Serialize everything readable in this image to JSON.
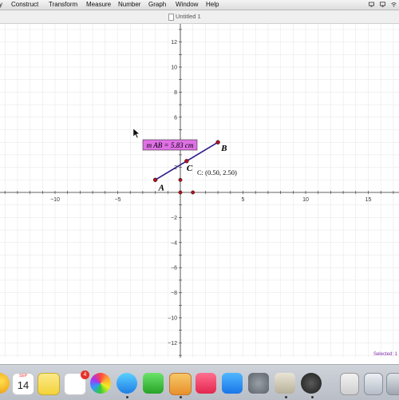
{
  "menu": {
    "items": [
      "y",
      "Construct",
      "Transform",
      "Measure",
      "Number",
      "Graph",
      "Window",
      "Help"
    ]
  },
  "window": {
    "title": "Untitled 1"
  },
  "graph": {
    "x_tick_labels": [
      "−10",
      "−5",
      "5",
      "10",
      "15"
    ],
    "x_tick_values": [
      -10,
      -5,
      5,
      10,
      15
    ],
    "y_tick_labels": [
      "12",
      "10",
      "8",
      "6",
      "4",
      "2",
      "−2",
      "−4",
      "−6",
      "−8",
      "−10",
      "−12"
    ],
    "y_tick_values": [
      12,
      10,
      8,
      6,
      4,
      2,
      -2,
      -4,
      -6,
      -8,
      -10,
      -12
    ],
    "points": [
      {
        "label": "A",
        "x": -2,
        "y": 1
      },
      {
        "label": "B",
        "x": 3,
        "y": 4
      },
      {
        "label": "C",
        "x": 0.5,
        "y": 2.5
      }
    ],
    "extra_points": [
      {
        "x": 0,
        "y": 1
      },
      {
        "x": 0,
        "y": 0
      },
      {
        "x": 1,
        "y": 0
      }
    ],
    "measurement": "m AB = 5.83 cm",
    "coord_label": "C: (0.50, 2.50)",
    "segment_color": "#2b1a8c",
    "point_color": "#b3111e",
    "measure_bg": "#e070e6"
  },
  "status": {
    "text": "Selected: 1"
  },
  "dock": {
    "calendar_month": "SEP",
    "calendar_day": "14",
    "reminders_badge": "4"
  }
}
